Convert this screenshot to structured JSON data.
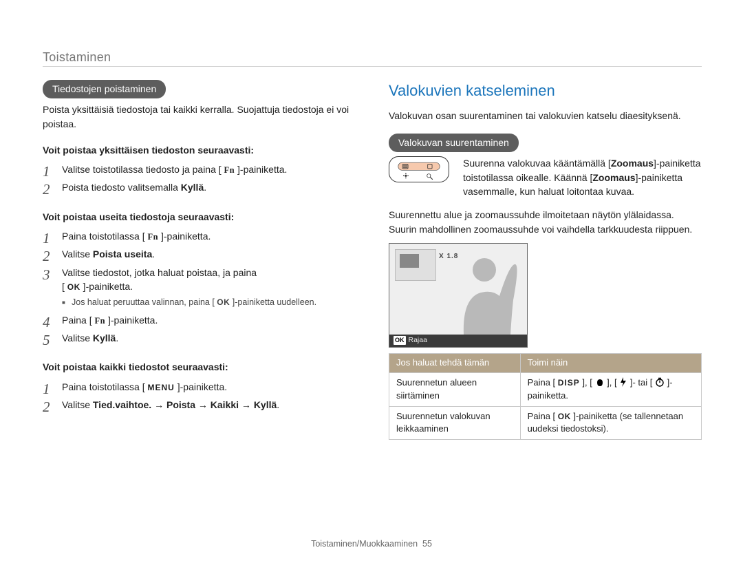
{
  "header": {
    "section": "Toistaminen"
  },
  "left": {
    "box_title": "Tiedostojen poistaminen",
    "intro": "Poista yksittäisiä tiedostoja tai kaikki kerralla. Suojattuja tiedostoja ei voi poistaa.",
    "single_head": "Voit poistaa yksittäisen tiedoston seuraavasti:",
    "single_steps": [
      {
        "pre": "Valitse toistotilassa tiedosto ja paina ",
        "btn": "Fn",
        "post": "-painiketta."
      },
      {
        "pre": "Poista tiedosto valitsemalla ",
        "bold": "Kyllä",
        "post": "."
      }
    ],
    "multi_head": "Voit poistaa useita tiedostoja seuraavasti:",
    "multi_steps": {
      "s1_pre": "Paina toistotilassa ",
      "s1_btn": "Fn",
      "s1_post": "-painiketta.",
      "s2_pre": "Valitse ",
      "s2_bold": "Poista useita",
      "s2_post": ".",
      "s3_pre": "Valitse tiedostot, jotka haluat poistaa, ja paina",
      "s3_btn": "OK",
      "s3_post": "-painiketta.",
      "s3_bullet_pre": "Jos haluat peruuttaa valinnan, paina ",
      "s3_bullet_btn": "OK",
      "s3_bullet_post": "-painiketta uudelleen.",
      "s4_pre": "Paina ",
      "s4_btn": "Fn",
      "s4_post": "-painiketta.",
      "s5_pre": "Valitse ",
      "s5_bold": "Kyllä",
      "s5_post": "."
    },
    "all_head": "Voit poistaa kaikki tiedostot seuraavasti:",
    "all_steps": {
      "s1_pre": "Paina toistotilassa ",
      "s1_btn": "MENU",
      "s1_post": "-painiketta.",
      "s2": "Valitse Tied.vaihtoe. → Poista → Kaikki → Kyllä.",
      "s2_pre": "Valitse ",
      "s2_b1": "Tied.vaihtoe.",
      "s2_arrow": " → ",
      "s2_b2": "Poista",
      "s2_b3": "Kaikki",
      "s2_b4": "Kyllä",
      "s2_post": "."
    }
  },
  "right": {
    "title": "Valokuvien katseleminen",
    "intro": "Valokuvan osan suurentaminen tai valokuvien katselu diaesityksenä.",
    "box_title": "Valokuvan suurentaminen",
    "zoom_text": {
      "a": "Suurenna valokuvaa kääntämällä ",
      "zoom_b1": "Zoomaus",
      "b": "-painiketta toistotilassa oikealle. Käännä ",
      "zoom_b2": "Zoomaus",
      "c": "-painiketta vasemmalle, kun haluat loitontaa kuvaa."
    },
    "para2": "Suurennettu alue ja zoomaussuhde ilmoitetaan näytön ylälaidassa. Suurin mahdollinen zoomaussuhde voi vaihdella tarkkuudesta riippuen.",
    "preview": {
      "mag": "X 1.8",
      "crop_label": "Rajaa"
    },
    "table": {
      "th1": "Jos haluat tehdä tämän",
      "th2": "Toimi näin",
      "r1c1": "Suurennetun alueen siirtäminen",
      "r1c2_pre": "Paina ",
      "r1c2_disp": "DISP",
      "r1c2_mid": "- tai ",
      "r1c2_post": "-painiketta.",
      "r2c1": "Suurennetun valokuvan leikkaaminen",
      "r2c2_pre": "Paina ",
      "r2c2_btn": "OK",
      "r2c2_post": "-painiketta (se tallennetaan uudeksi tiedostoksi)."
    }
  },
  "footer": {
    "text": "Toistaminen/Muokkaaminen",
    "page": "55"
  }
}
